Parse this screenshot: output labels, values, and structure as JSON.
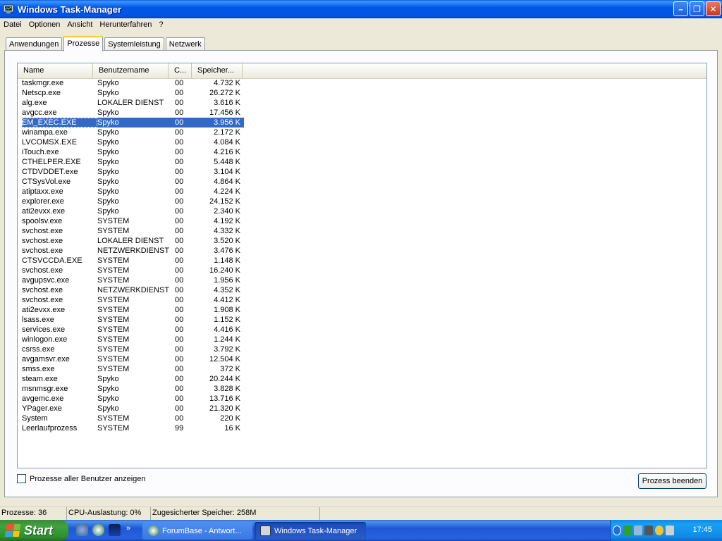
{
  "window": {
    "title": "Windows Task-Manager",
    "min_symbol": "–",
    "max_symbol": "❐",
    "close_symbol": "✕"
  },
  "menu": [
    "Datei",
    "Optionen",
    "Ansicht",
    "Herunterfahren",
    "?"
  ],
  "tabs": [
    {
      "label": "Anwendungen",
      "active": false
    },
    {
      "label": "Prozesse",
      "active": true
    },
    {
      "label": "Systemleistung",
      "active": false
    },
    {
      "label": "Netzwerk",
      "active": false
    }
  ],
  "columns": [
    "Name",
    "Benutzername",
    "C...",
    "Speicher..."
  ],
  "processes": [
    {
      "name": "taskmgr.exe",
      "user": "Spyko",
      "cpu": "00",
      "mem": "4.732 K"
    },
    {
      "name": "Netscp.exe",
      "user": "Spyko",
      "cpu": "00",
      "mem": "26.272 K"
    },
    {
      "name": "alg.exe",
      "user": "LOKALER DIENST",
      "cpu": "00",
      "mem": "3.616 K"
    },
    {
      "name": "avgcc.exe",
      "user": "Spyko",
      "cpu": "00",
      "mem": "17.456 K"
    },
    {
      "name": "EM_EXEC.EXE",
      "user": "Spyko",
      "cpu": "00",
      "mem": "3.956 K",
      "selected": true
    },
    {
      "name": "winampa.exe",
      "user": "Spyko",
      "cpu": "00",
      "mem": "2.172 K"
    },
    {
      "name": "LVCOMSX.EXE",
      "user": "Spyko",
      "cpu": "00",
      "mem": "4.084 K"
    },
    {
      "name": "iTouch.exe",
      "user": "Spyko",
      "cpu": "00",
      "mem": "4.216 K"
    },
    {
      "name": "CTHELPER.EXE",
      "user": "Spyko",
      "cpu": "00",
      "mem": "5.448 K"
    },
    {
      "name": "CTDVDDET.exe",
      "user": "Spyko",
      "cpu": "00",
      "mem": "3.104 K"
    },
    {
      "name": "CTSysVol.exe",
      "user": "Spyko",
      "cpu": "00",
      "mem": "4.864 K"
    },
    {
      "name": "atiptaxx.exe",
      "user": "Spyko",
      "cpu": "00",
      "mem": "4.224 K"
    },
    {
      "name": "explorer.exe",
      "user": "Spyko",
      "cpu": "00",
      "mem": "24.152 K"
    },
    {
      "name": "ati2evxx.exe",
      "user": "Spyko",
      "cpu": "00",
      "mem": "2.340 K"
    },
    {
      "name": "spoolsv.exe",
      "user": "SYSTEM",
      "cpu": "00",
      "mem": "4.192 K"
    },
    {
      "name": "svchost.exe",
      "user": "SYSTEM",
      "cpu": "00",
      "mem": "4.332 K"
    },
    {
      "name": "svchost.exe",
      "user": "LOKALER DIENST",
      "cpu": "00",
      "mem": "3.520 K"
    },
    {
      "name": "svchost.exe",
      "user": "NETZWERKDIENST",
      "cpu": "00",
      "mem": "3.476 K"
    },
    {
      "name": "CTSVCCDA.EXE",
      "user": "SYSTEM",
      "cpu": "00",
      "mem": "1.148 K"
    },
    {
      "name": "svchost.exe",
      "user": "SYSTEM",
      "cpu": "00",
      "mem": "16.240 K"
    },
    {
      "name": "avgupsvc.exe",
      "user": "SYSTEM",
      "cpu": "00",
      "mem": "1.956 K"
    },
    {
      "name": "svchost.exe",
      "user": "NETZWERKDIENST",
      "cpu": "00",
      "mem": "4.352 K"
    },
    {
      "name": "svchost.exe",
      "user": "SYSTEM",
      "cpu": "00",
      "mem": "4.412 K"
    },
    {
      "name": "ati2evxx.exe",
      "user": "SYSTEM",
      "cpu": "00",
      "mem": "1.908 K"
    },
    {
      "name": "lsass.exe",
      "user": "SYSTEM",
      "cpu": "00",
      "mem": "1.152 K"
    },
    {
      "name": "services.exe",
      "user": "SYSTEM",
      "cpu": "00",
      "mem": "4.416 K"
    },
    {
      "name": "winlogon.exe",
      "user": "SYSTEM",
      "cpu": "00",
      "mem": "1.244 K"
    },
    {
      "name": "csrss.exe",
      "user": "SYSTEM",
      "cpu": "00",
      "mem": "3.792 K"
    },
    {
      "name": "avgamsvr.exe",
      "user": "SYSTEM",
      "cpu": "00",
      "mem": "12.504 K"
    },
    {
      "name": "smss.exe",
      "user": "SYSTEM",
      "cpu": "00",
      "mem": "372 K"
    },
    {
      "name": "steam.exe",
      "user": "Spyko",
      "cpu": "00",
      "mem": "20.244 K"
    },
    {
      "name": "msnmsgr.exe",
      "user": "Spyko",
      "cpu": "00",
      "mem": "3.828 K"
    },
    {
      "name": "avgemc.exe",
      "user": "Spyko",
      "cpu": "00",
      "mem": "13.716 K"
    },
    {
      "name": "YPager.exe",
      "user": "Spyko",
      "cpu": "00",
      "mem": "21.320 K"
    },
    {
      "name": "System",
      "user": "SYSTEM",
      "cpu": "00",
      "mem": "220 K"
    },
    {
      "name": "Leerlaufprozess",
      "user": "SYSTEM",
      "cpu": "99",
      "mem": "16 K"
    }
  ],
  "show_all_users_label": "Prozesse aller Benutzer anzeigen",
  "end_process_label": "Prozess beenden",
  "status": {
    "processes": "Prozesse: 36",
    "cpu": "CPU-Auslastung: 0%",
    "memory": "Zugesicherter Speicher: 258M"
  },
  "taskbar": {
    "start_label": "Start",
    "chevron": "»",
    "buttons": [
      {
        "label": "ForumBase - Antwort...",
        "icon": "netscape-icon"
      },
      {
        "label": "Windows Task-Manager",
        "icon": "taskmanager-icon"
      }
    ],
    "clock": "17:45"
  },
  "colors": {
    "titlebar": "#0054e3",
    "selection": "#316ac5",
    "start_green": "#3fa33f",
    "tray_blue": "#1289e4"
  }
}
